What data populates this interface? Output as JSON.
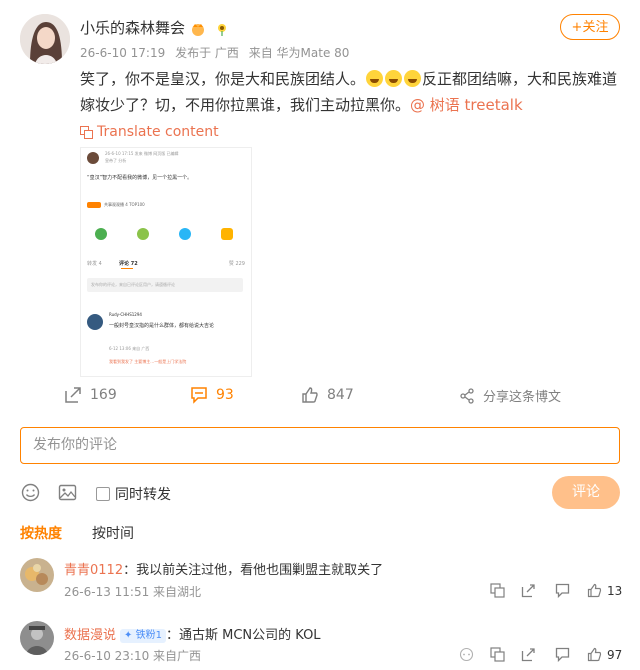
{
  "post": {
    "author": "小乐的森林舞会",
    "date": "26-6-10 17:19",
    "posted_from": "发布于 广西",
    "device": "来自 华为Mate 80",
    "follow_label": "+关注",
    "text_a": "笑了，你不是皇汉，你是大和民族团结人。",
    "text_b": "反正都团结嘛，大和民族难道嫁妆少了？切，不用你拉黑谁，我们主动拉黑你。",
    "mention": "@ 树语 treetalk",
    "translate_label": "Translate content"
  },
  "embedded": {
    "line1": "26-6-10 17:15  发来 微博 网页版  已编辑",
    "line2": "皇帝了 分析",
    "quote": "“皇汉”智力不配看我的微博，见一个拉黑一个。",
    "tag": "共事观观播 4 TOP100",
    "tab_a": "转发 4",
    "tab_b": "评论 72",
    "tab_c": "赞 229",
    "input_hint": "发布你的评论，来自已评论区用户，请遵循评论",
    "c1_name": "Rudy-CHHS1294",
    "c1_text": "一般封号皇汉指的是什么群体，都有给说大吉论",
    "c1_date": "6-12 13:06 来自 广西",
    "c2_text": "我看到我发了 主要博主…一般是上门学法院"
  },
  "actions": {
    "repost": "169",
    "comment": "93",
    "like": "847",
    "share_label": "分享这条博文"
  },
  "composer": {
    "placeholder": "发布你的评论",
    "repost_check": "同时转发",
    "submit": "评论"
  },
  "sort": {
    "hot": "按热度",
    "time": "按时间"
  },
  "comments": [
    {
      "name": "青青0112",
      "text": "：我以前关注过他，看他也围剿盟主就取关了",
      "date": "26-6-13 11:51 来自湖北",
      "likes": "13"
    },
    {
      "name": "数据漫说",
      "fan_tag": "铁粉1",
      "text": "：通古斯 MCN公司的 KOL",
      "date": "26-6-10 23:10 来自广西",
      "likes": "97"
    }
  ],
  "colors": {
    "accent": "#ff8200",
    "link": "#eb7350",
    "muted": "#939393"
  }
}
